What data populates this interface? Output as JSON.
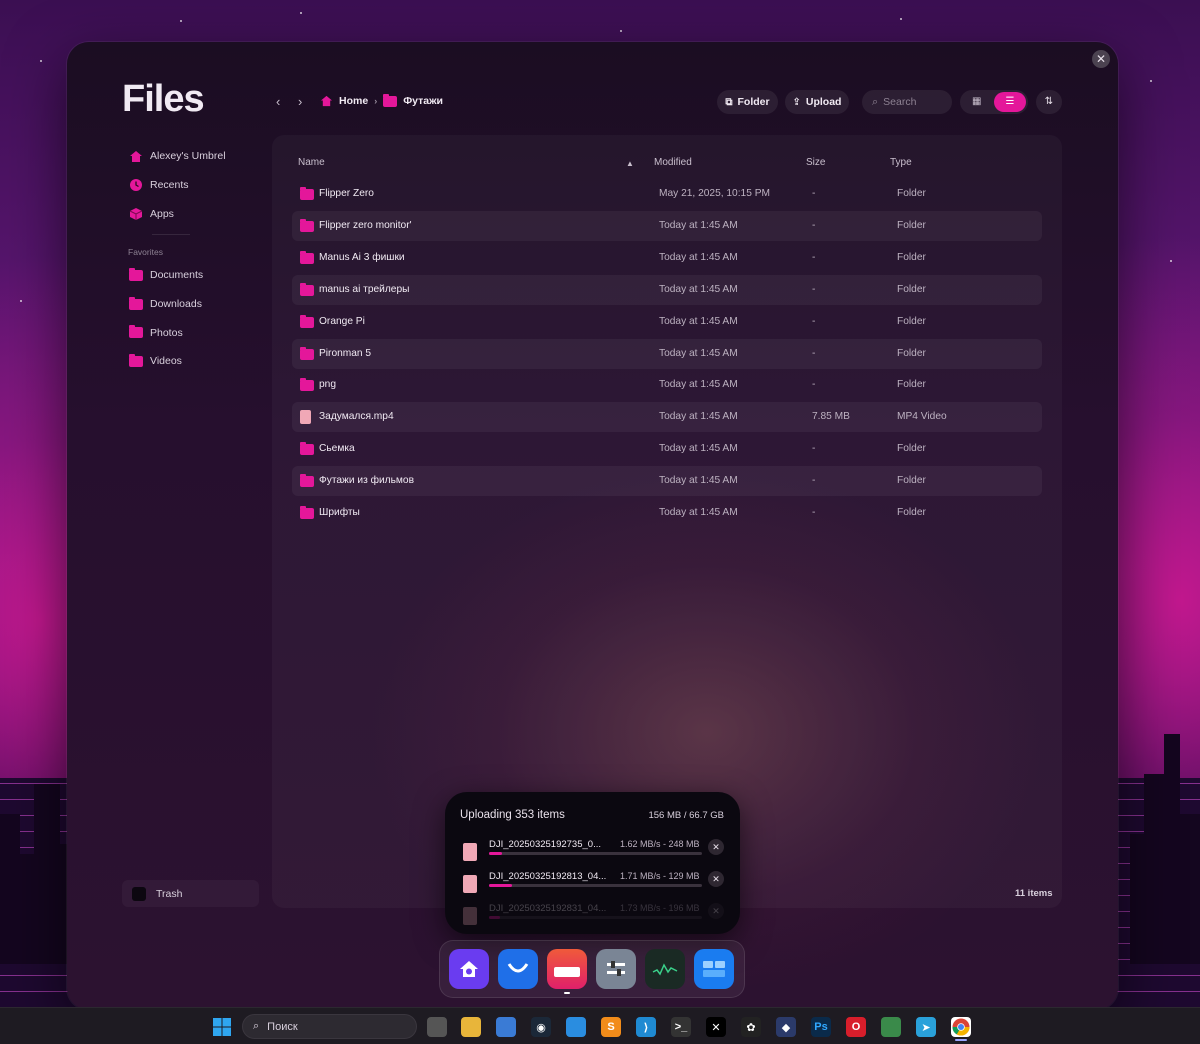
{
  "app": {
    "title": "Files"
  },
  "sidebar": {
    "items": [
      {
        "label": "Alexey's Umbrel",
        "icon": "home-icon"
      },
      {
        "label": "Recents",
        "icon": "clock-icon"
      },
      {
        "label": "Apps",
        "icon": "cube-icon"
      }
    ],
    "favorites_label": "Favorites",
    "favorites": [
      {
        "label": "Documents",
        "icon": "folder-icon"
      },
      {
        "label": "Downloads",
        "icon": "folder-icon"
      },
      {
        "label": "Photos",
        "icon": "folder-icon"
      },
      {
        "label": "Videos",
        "icon": "folder-icon"
      }
    ],
    "trash_label": "Trash"
  },
  "toolbar": {
    "breadcrumb": [
      {
        "label": "Home"
      },
      {
        "label": "Футажи"
      }
    ],
    "folder_label": "Folder",
    "upload_label": "Upload",
    "search_placeholder": "Search"
  },
  "table": {
    "columns": {
      "name": "Name",
      "modified": "Modified",
      "size": "Size",
      "type": "Type"
    },
    "rows": [
      {
        "name": "Flipper Zero",
        "modified": "May 21, 2025, 10:15 PM",
        "size": "-",
        "type": "Folder",
        "kind": "folder"
      },
      {
        "name": "Flipper zero monitor'",
        "modified": "Today at 1:45 AM",
        "size": "-",
        "type": "Folder",
        "kind": "folder"
      },
      {
        "name": "Manus Ai 3 фишки",
        "modified": "Today at 1:45 AM",
        "size": "-",
        "type": "Folder",
        "kind": "folder"
      },
      {
        "name": "manus ai трейлеры",
        "modified": "Today at 1:45 AM",
        "size": "-",
        "type": "Folder",
        "kind": "folder"
      },
      {
        "name": "Orange Pi",
        "modified": "Today at 1:45 AM",
        "size": "-",
        "type": "Folder",
        "kind": "folder"
      },
      {
        "name": "Pironman 5",
        "modified": "Today at 1:45 AM",
        "size": "-",
        "type": "Folder",
        "kind": "folder"
      },
      {
        "name": "png",
        "modified": "Today at 1:45 AM",
        "size": "-",
        "type": "Folder",
        "kind": "folder"
      },
      {
        "name": "Задумался.mp4",
        "modified": "Today at 1:45 AM",
        "size": "7.85 MB",
        "type": "MP4 Video",
        "kind": "file"
      },
      {
        "name": "Сьемка",
        "modified": "Today at 1:45 AM",
        "size": "-",
        "type": "Folder",
        "kind": "folder"
      },
      {
        "name": "Футажи из фильмов",
        "modified": "Today at 1:45 AM",
        "size": "-",
        "type": "Folder",
        "kind": "folder"
      },
      {
        "name": "Шрифты",
        "modified": "Today at 1:45 AM",
        "size": "-",
        "type": "Folder",
        "kind": "folder"
      }
    ],
    "items_count": "11 items"
  },
  "upload": {
    "title": "Uploading 353 items",
    "total": "156 MB / 66.7 GB",
    "files": [
      {
        "name": "DJI_20250325192735_0...",
        "speed": "1.62 MB/s - 248 MB",
        "progress": 0.06
      },
      {
        "name": "DJI_20250325192813_04...",
        "speed": "1.71 MB/s - 129 MB",
        "progress": 0.11
      },
      {
        "name": "DJI_20250325192831_04...",
        "speed": "1.73 MB/s - 196 MB",
        "progress": 0.05
      }
    ]
  },
  "dock": {
    "apps": [
      {
        "name": "home-app-icon",
        "color": "#6a3cf0"
      },
      {
        "name": "inbox-app-icon",
        "color": "#1f6fe8"
      },
      {
        "name": "files-app-icon",
        "color": "#f05a3a"
      },
      {
        "name": "settings-app-icon",
        "color": "#7a8595"
      },
      {
        "name": "monitor-app-icon",
        "color": "#1a2a24"
      },
      {
        "name": "widgets-app-icon",
        "color": "#1a7cf0"
      }
    ]
  },
  "taskbar": {
    "search_placeholder": "Поиск",
    "ps_label": "Ps"
  },
  "colors": {
    "accent": "#e4179a",
    "panel": "#260f2e"
  }
}
